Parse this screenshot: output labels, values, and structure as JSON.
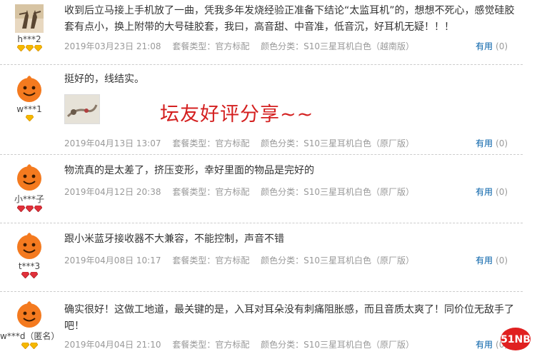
{
  "overlay_text": "坛友好评分享~~",
  "watermark_text": "51NB",
  "colors": {
    "gem": "#f5b800",
    "gem_red": "#e0303a",
    "useful_link": "#005ea7",
    "overlay": "#d42020"
  },
  "reviews": [
    {
      "user": "h***2",
      "badge": "gold-gem-icon",
      "badge_count": 3,
      "text": "收到后立马接上手机放了一曲，凭我多年发烧经验正准备下结论“太监耳机”的，想想不死心，感觉硅胶套有点小，换上附带的大号硅胶套，我曰，高音甜、中音准，低音沉，好耳机无疑！！！",
      "date": "2019年03月23日 21:08",
      "package": "套餐类型：官方标配",
      "color": "颜色分类：S10三星耳机白色（越南版）",
      "useful_label": "有用",
      "useful_count": "(0)"
    },
    {
      "user": "w***1",
      "badge": "gold-gem-icon",
      "badge_count": 1,
      "text": "挺好的，线结实。",
      "date": "2019年04月13日 13:07",
      "package": "套餐类型：官方标配",
      "color": "颜色分类：S10三星耳机白色（原厂版）",
      "useful_label": "有用",
      "useful_count": "(0)"
    },
    {
      "user": "小***子",
      "badge": "red-gem-icon",
      "badge_count": 3,
      "text": "物流真的是太差了，挤压变形，幸好里面的物品是完好的",
      "date": "2019年04月12日 20:38",
      "package": "套餐类型：官方标配",
      "color": "颜色分类：S10三星耳机白色（原厂版）",
      "useful_label": "有用",
      "useful_count": "(0)"
    },
    {
      "user": "t***3",
      "badge": "red-gem-icon",
      "badge_count": 2,
      "text": "跟小米蓝牙接收器不大兼容，不能控制，声音不错",
      "date": "2019年04月08日 10:17",
      "package": "套餐类型：官方标配",
      "color": "颜色分类：S10三星耳机白色（原厂版）",
      "useful_label": "有用",
      "useful_count": "(0)"
    },
    {
      "user": "w***d（匿名）",
      "badge": "gold-gem-icon",
      "badge_count": 2,
      "text": "确实很好！这做工地道，最关键的是，入耳对耳朵没有刺痛阻胀感，而且音质太爽了！同价位无敌手了吧！",
      "date": "2019年04月04日 21:10",
      "package": "套餐类型：官方标配",
      "color": "颜色分类：S10三星耳机白色（原厂版）",
      "useful_label": "有用",
      "useful_count": "(0)"
    }
  ]
}
